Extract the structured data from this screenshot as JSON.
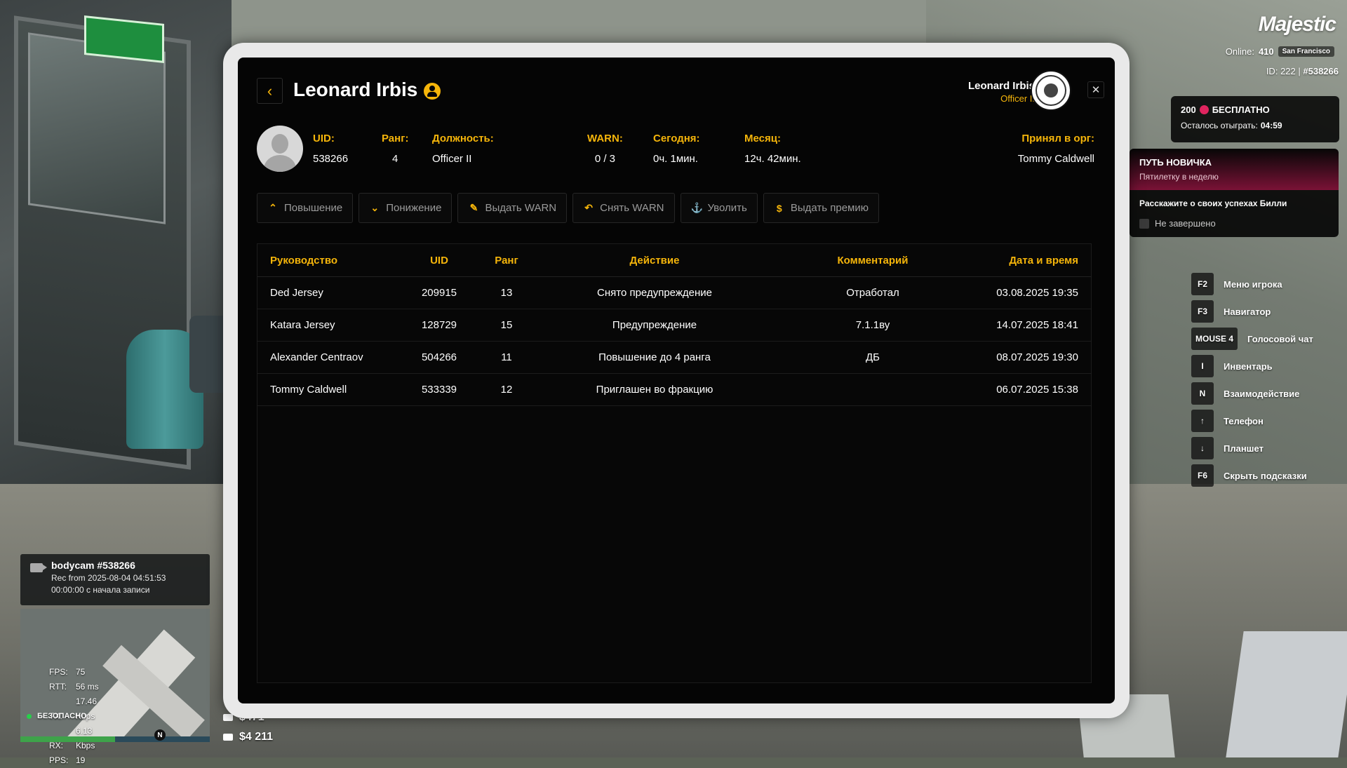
{
  "hud": {
    "logo": "Majestic",
    "online_label": "Online:",
    "online_count": "410",
    "server": "San Francisco",
    "id_label": "ID:",
    "id_value": "222 |",
    "static_id": "#538266",
    "promo": {
      "amount": "200",
      "label": "БЕСПЛАТНО",
      "remaining_label": "Осталось отыграть:",
      "remaining_time": "04:59"
    },
    "quest": {
      "title": "ПУТЬ НОВИЧКА",
      "subtitle": "Пятилетку в неделю",
      "task": "Расскажите о своих успехах Билли",
      "status": "Не завершено"
    },
    "hotkeys": [
      {
        "key": "F2",
        "label": "Меню игрока"
      },
      {
        "key": "F3",
        "label": "Навигатор"
      },
      {
        "key": "MOUSE 4",
        "label": "Голосовой чат"
      },
      {
        "key": "I",
        "label": "Инвентарь"
      },
      {
        "key": "N",
        "label": "Взаимодействие"
      },
      {
        "key": "↑",
        "label": "Телефон"
      },
      {
        "key": "↓",
        "label": "Планшет"
      },
      {
        "key": "F6",
        "label": "Скрыть подсказки"
      }
    ],
    "bodycam": {
      "title": "bodycam #538266",
      "rec": "Rec from 2025-08-04 04:51:53",
      "elapsed": "00:00:00 с начала записи"
    },
    "stats": [
      {
        "k": "FPS:",
        "v": "75"
      },
      {
        "k": "RTT:",
        "v": "56 ms"
      },
      {
        "k": "TX:",
        "v": "17.46 Kbps"
      },
      {
        "k": "RX:",
        "v": "6.13 Kbps"
      },
      {
        "k": "PPS:",
        "v": "19"
      }
    ],
    "safe_zone": "БЕЗОПАСНО",
    "compass": "N",
    "money_top": "$471",
    "money_bank": "$4 211"
  },
  "profile": {
    "name": "Leonard Irbis",
    "uid_label": "UID:",
    "uid": "538266",
    "rank_label": "Ранг:",
    "rank": "4",
    "position_label": "Должность:",
    "position": "Officer II",
    "warn_label": "WARN:",
    "warn": "0 / 3",
    "today_label": "Сегодня:",
    "today": "0ч. 1мин.",
    "month_label": "Месяц:",
    "month": "12ч. 42мин.",
    "accepted_label": "Принял в орг:",
    "accepted_by": "Tommy Caldwell"
  },
  "viewer": {
    "name": "Leonard Irbis",
    "rank": "Officer II"
  },
  "actions": [
    {
      "label": "Повышение",
      "icon": "arrow-up-icon"
    },
    {
      "label": "Понижение",
      "icon": "arrow-down-icon"
    },
    {
      "label": "Выдать WARN",
      "icon": "warn-add-icon"
    },
    {
      "label": "Снять WARN",
      "icon": "undo-icon"
    },
    {
      "label": "Уволить",
      "icon": "fire-icon"
    },
    {
      "label": "Выдать премию",
      "icon": "coin-icon"
    }
  ],
  "table": {
    "headers": [
      "Руководство",
      "UID",
      "Ранг",
      "Действие",
      "Комментарий",
      "Дата и время"
    ],
    "rows": [
      [
        "Ded Jersey",
        "209915",
        "13",
        "Снято предупреждение",
        "Отработал",
        "03.08.2025 19:35"
      ],
      [
        "Katara Jersey",
        "128729",
        "15",
        "Предупреждение",
        "7.1.1ву",
        "14.07.2025 18:41"
      ],
      [
        "Alexander Centraov",
        "504266",
        "11",
        "Повышение до 4 ранга",
        "ДБ",
        "08.07.2025 19:30"
      ],
      [
        "Tommy Caldwell",
        "533339",
        "12",
        "Приглашен во фракцию",
        "",
        "06.07.2025 15:38"
      ]
    ]
  },
  "colors": {
    "accent": "#f5b50a",
    "panel": "#050505",
    "quest": "#7a1236"
  }
}
